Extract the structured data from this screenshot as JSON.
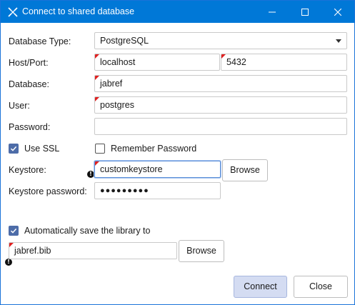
{
  "window": {
    "title": "Connect to shared database",
    "app_icon": "jabref-icon",
    "controls": [
      "minimize-icon",
      "maximize-icon",
      "close-icon"
    ]
  },
  "form": {
    "database_type": {
      "label": "Database Type:",
      "value": "PostgreSQL"
    },
    "host_port": {
      "label": "Host/Port:",
      "host": "localhost",
      "port": "5432"
    },
    "database": {
      "label": "Database:",
      "value": "jabref"
    },
    "user": {
      "label": "User:",
      "value": "postgres"
    },
    "password": {
      "label": "Password:",
      "value": ""
    },
    "use_ssl": {
      "label": "Use SSL",
      "checked": true
    },
    "remember_password": {
      "label": "Remember Password",
      "checked": false
    },
    "keystore": {
      "label": "Keystore:",
      "value": "customkeystore",
      "browse_label": "Browse"
    },
    "keystore_password": {
      "label": "Keystore password:",
      "masked_value": "●●●●●●●●●"
    },
    "autosave": {
      "label": "Automatically save the library to",
      "checked": true
    },
    "autosave_path": {
      "value": "jabref.bib",
      "browse_label": "Browse"
    }
  },
  "buttons": {
    "connect": "Connect",
    "close": "Close"
  },
  "colors": {
    "titlebar": "#0078d7",
    "required_marker": "#e02020",
    "checkbox": "#4d6ca8",
    "primary_button": "#d4dcf2"
  }
}
